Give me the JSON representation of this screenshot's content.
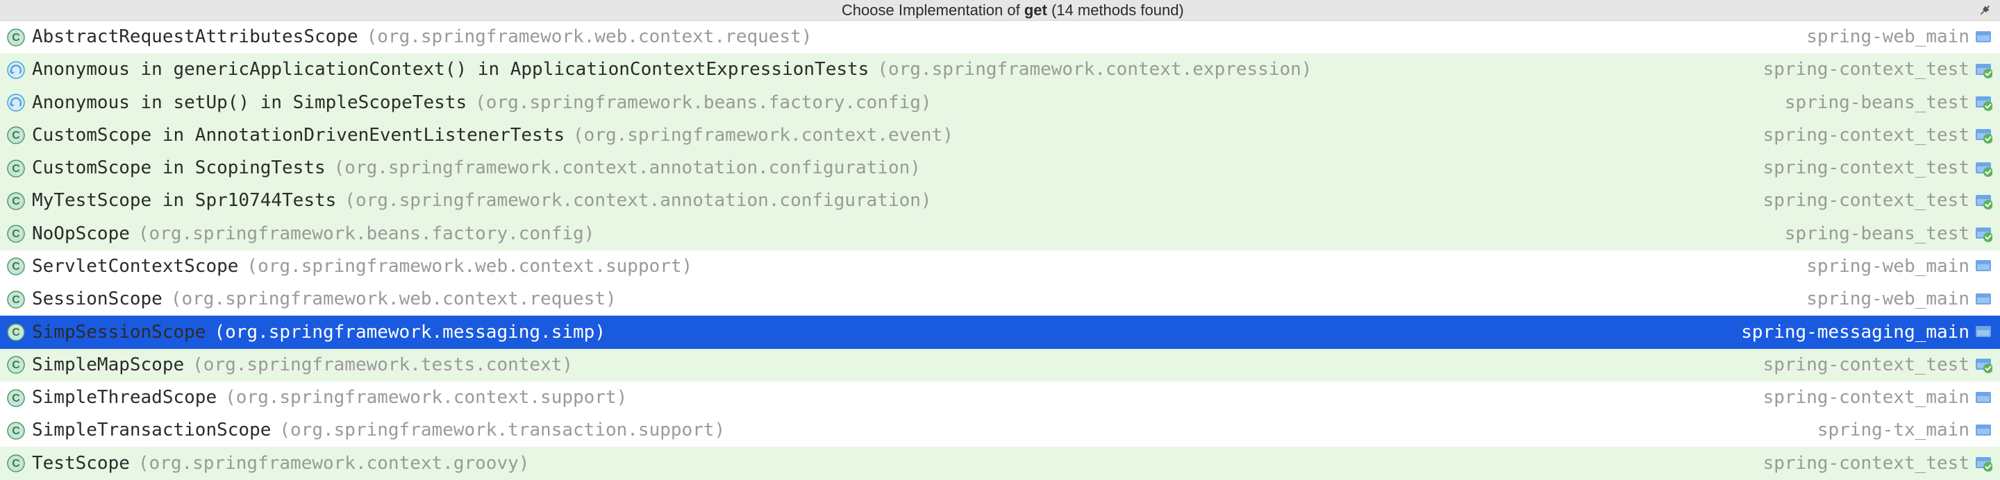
{
  "header": {
    "title_prefix": "Choose Implementation of ",
    "title_bold": "get",
    "title_suffix": " (14 methods found)"
  },
  "rows": [
    {
      "icon": "class",
      "test": false,
      "selected": false,
      "class": "AbstractRequestAttributesScope",
      "pkg": "(org.springframework.web.context.request)",
      "module": "spring-web_main",
      "modicon": "source"
    },
    {
      "icon": "anon",
      "test": true,
      "selected": false,
      "class": "Anonymous in genericApplicationContext() in ApplicationContextExpressionTests",
      "pkg": "(org.springframework.context.expression)",
      "module": "spring-context_test",
      "modicon": "test"
    },
    {
      "icon": "anon",
      "test": true,
      "selected": false,
      "class": "Anonymous in setUp() in SimpleScopeTests",
      "pkg": "(org.springframework.beans.factory.config)",
      "module": "spring-beans_test",
      "modicon": "test"
    },
    {
      "icon": "class",
      "test": true,
      "selected": false,
      "class": "CustomScope in AnnotationDrivenEventListenerTests",
      "pkg": "(org.springframework.context.event)",
      "module": "spring-context_test",
      "modicon": "test"
    },
    {
      "icon": "class",
      "test": true,
      "selected": false,
      "class": "CustomScope in ScopingTests",
      "pkg": "(org.springframework.context.annotation.configuration)",
      "module": "spring-context_test",
      "modicon": "test"
    },
    {
      "icon": "class",
      "test": true,
      "selected": false,
      "class": "MyTestScope in Spr10744Tests",
      "pkg": "(org.springframework.context.annotation.configuration)",
      "module": "spring-context_test",
      "modicon": "test"
    },
    {
      "icon": "class",
      "test": true,
      "selected": false,
      "class": "NoOpScope",
      "pkg": "(org.springframework.beans.factory.config)",
      "module": "spring-beans_test",
      "modicon": "test"
    },
    {
      "icon": "class",
      "test": false,
      "selected": false,
      "class": "ServletContextScope",
      "pkg": "(org.springframework.web.context.support)",
      "module": "spring-web_main",
      "modicon": "source"
    },
    {
      "icon": "class",
      "test": false,
      "selected": false,
      "class": "SessionScope",
      "pkg": "(org.springframework.web.context.request)",
      "module": "spring-web_main",
      "modicon": "source"
    },
    {
      "icon": "class",
      "test": false,
      "selected": true,
      "class": "SimpSessionScope",
      "pkg": "(org.springframework.messaging.simp)",
      "module": "spring-messaging_main",
      "modicon": "source"
    },
    {
      "icon": "class",
      "test": true,
      "selected": false,
      "class": "SimpleMapScope",
      "pkg": "(org.springframework.tests.context)",
      "module": "spring-context_test",
      "modicon": "test"
    },
    {
      "icon": "class",
      "test": false,
      "selected": false,
      "class": "SimpleThreadScope",
      "pkg": "(org.springframework.context.support)",
      "module": "spring-context_main",
      "modicon": "source"
    },
    {
      "icon": "class",
      "test": false,
      "selected": false,
      "class": "SimpleTransactionScope",
      "pkg": "(org.springframework.transaction.support)",
      "module": "spring-tx_main",
      "modicon": "source"
    },
    {
      "icon": "class",
      "test": true,
      "selected": false,
      "class": "TestScope",
      "pkg": "(org.springframework.context.groovy)",
      "module": "spring-context_test",
      "modicon": "test"
    }
  ]
}
